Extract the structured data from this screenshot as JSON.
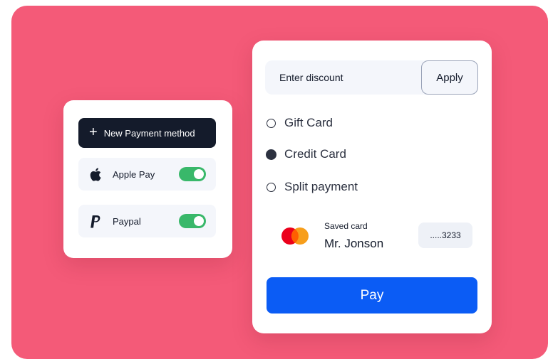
{
  "colors": {
    "backdrop": "#f45a78",
    "card": "#ffffff",
    "dark_button": "#141b2b",
    "toggle_on": "#39b86a",
    "pay_button": "#0b5cf5",
    "mastercard_red": "#eb001b",
    "mastercard_orange": "#f79e1b"
  },
  "payment_methods": {
    "new_method_label": "New Payment method",
    "items": [
      {
        "icon": "apple-icon",
        "label": "Apple Pay",
        "enabled": true
      },
      {
        "icon": "paypal-icon",
        "label": "Paypal",
        "enabled": true
      }
    ]
  },
  "checkout": {
    "discount": {
      "placeholder": "Enter discount",
      "value": "",
      "apply_label": "Apply"
    },
    "options": [
      {
        "label": "Gift Card",
        "selected": false
      },
      {
        "label": "Credit Card",
        "selected": true
      },
      {
        "label": "Split payment",
        "selected": false
      }
    ],
    "saved_card": {
      "brand_icon": "mastercard-icon",
      "label": "Saved card",
      "holder": "Mr. Jonson",
      "number_masked": ".....3233"
    },
    "pay_label": "Pay"
  }
}
